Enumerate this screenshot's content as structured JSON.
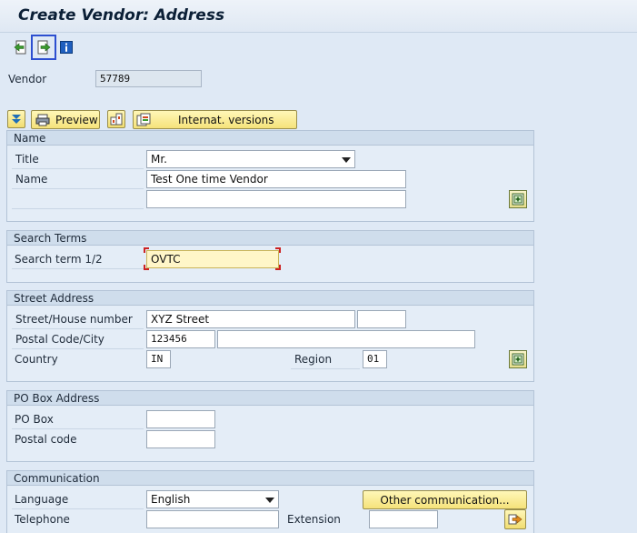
{
  "window": {
    "title": "Create Vendor: Address"
  },
  "toolbar": {
    "icons": [
      "previous-screen-icon",
      "next-screen-icon",
      "info-icon"
    ]
  },
  "vendor": {
    "label": "Vendor",
    "value": "57789"
  },
  "actions": {
    "preview_label": "Preview",
    "internat_label": "Internat. versions"
  },
  "name_group": {
    "title": "Name",
    "title_label": "Title",
    "title_value": "Mr.",
    "name_label": "Name",
    "name_value": "Test One time Vendor",
    "name2_value": ""
  },
  "search_group": {
    "title": "Search Terms",
    "label": "Search term 1/2",
    "value": "OVTC"
  },
  "street_group": {
    "title": "Street Address",
    "street_label": "Street/House number",
    "street_value": "XYZ Street",
    "house_value": "",
    "postal_label": "Postal Code/City",
    "postal_value": "123456",
    "city_value": "",
    "country_label": "Country",
    "country_value": "IN",
    "region_label": "Region",
    "region_value": "01"
  },
  "pobox_group": {
    "title": "PO Box Address",
    "pobox_label": "PO Box",
    "pobox_value": "",
    "postal_label": "Postal code",
    "postal_value": ""
  },
  "comm_group": {
    "title": "Communication",
    "language_label": "Language",
    "language_value": "English",
    "other_comm_label": "Other communication...",
    "telephone_label": "Telephone",
    "telephone_value": "",
    "extension_label": "Extension",
    "extension_value": ""
  }
}
